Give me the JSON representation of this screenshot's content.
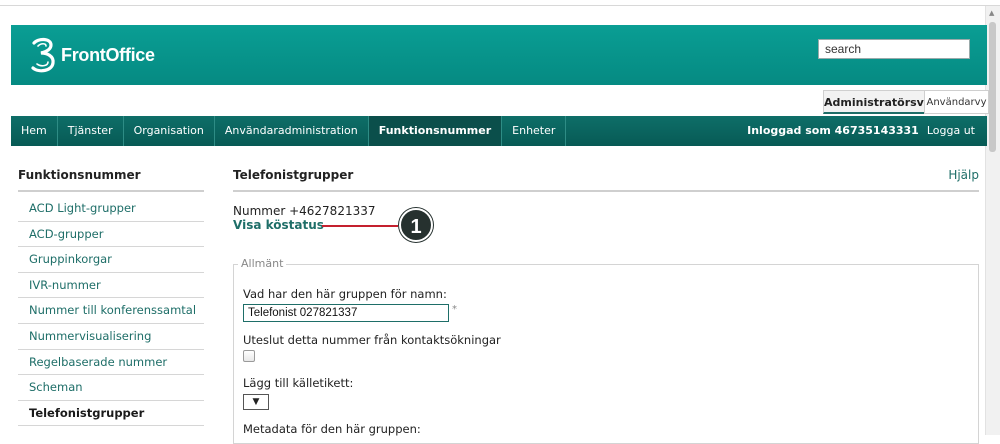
{
  "brand": {
    "name": "FrontOffice",
    "logo_icon": "three-logo-icon"
  },
  "search": {
    "value": "search"
  },
  "views": {
    "admin": "Administratörsvy",
    "user": "Användarvy"
  },
  "nav": {
    "items": [
      "Hem",
      "Tjänster",
      "Organisation",
      "Användaradministration",
      "Funktionsnummer",
      "Enheter"
    ],
    "active": "Funktionsnummer",
    "login_text": "Inloggad som 46735143331",
    "logout": "Logga ut"
  },
  "sidebar": {
    "title": "Funktionsnummer",
    "items": [
      "ACD Light-grupper",
      "ACD-grupper",
      "Gruppinkorgar",
      "IVR-nummer",
      "Nummer till konferenssamtal",
      "Nummervisualisering",
      "Regelbaserade nummer",
      "Scheman",
      "Telefonistgrupper"
    ],
    "active": "Telefonistgrupper"
  },
  "main": {
    "title": "Telefonistgrupper",
    "help": "Hjälp",
    "number": "Nummer +4627821337",
    "queue_link": "Visa köstatus",
    "callout": "1",
    "fieldset_legend": "Allmänt",
    "name_label": "Vad har den här gruppen för namn:",
    "name_value": "Telefonist 027821337",
    "required_mark": "*",
    "exclude_label": "Uteslut detta nummer från kontaktsökningar",
    "source_label": "Lägg till källetikett:",
    "source_select": "▼",
    "metadata_label": "Metadata för den här gruppen:"
  },
  "colors": {
    "brand_teal": "#0a9e94",
    "nav_dark": "#0e6e68",
    "link": "#1e6e68",
    "callout_line": "#c4202e"
  }
}
